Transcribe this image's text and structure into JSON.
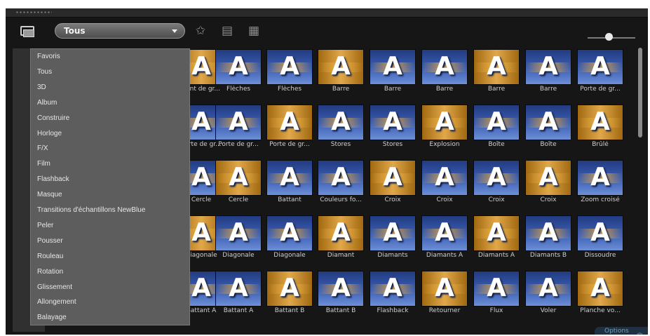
{
  "filter": {
    "selected": "Tous"
  },
  "dropdown": {
    "items": [
      "Favoris",
      "Tous",
      "3D",
      "Album",
      "Construire",
      "Horloge",
      "F/X",
      "Film",
      "Flashback",
      "Masque",
      "Transitions d'échantillons NewBlue",
      "Peler",
      "Pousser",
      "Rouleau",
      "Rotation",
      "Glissement",
      "Allongement",
      "Balayage"
    ]
  },
  "transitions": [
    [
      "Pont de gr...",
      "Flèches",
      "Flèches",
      "Barre",
      "Barre",
      "Barre",
      "Barre",
      "Barre",
      "Porte de gr..."
    ],
    [
      "Porte de gr...",
      "Porte de gr...",
      "Porte de gr...",
      "Stores",
      "Stores",
      "Explosion",
      "Boîte",
      "Boîte",
      "Brûlé"
    ],
    [
      "Cercle",
      "Cercle",
      "Battant",
      "Couleurs fo...",
      "Croix",
      "Croix",
      "Croix",
      "Croix",
      "Zoom croisé"
    ],
    [
      "Diagonale",
      "Diagonale",
      "Diagonale",
      "Diamant",
      "Diamants",
      "Diamants A",
      "Diamants A",
      "Diamants B",
      "Dissoudre"
    ],
    [
      "Battant A",
      "Battant A",
      "Battant B",
      "Battant B",
      "Flashback",
      "Retourner",
      "Flux",
      "Voler",
      "Planche vo..."
    ]
  ],
  "thumb_glyph": "A",
  "options": {
    "label": "Options",
    "icon": "double-chevron-up-icon"
  },
  "colors": {
    "thumb_blue": "#3c5fb5",
    "thumb_gold": "#e1a84a",
    "menu_bg": "#5d5d5d"
  }
}
